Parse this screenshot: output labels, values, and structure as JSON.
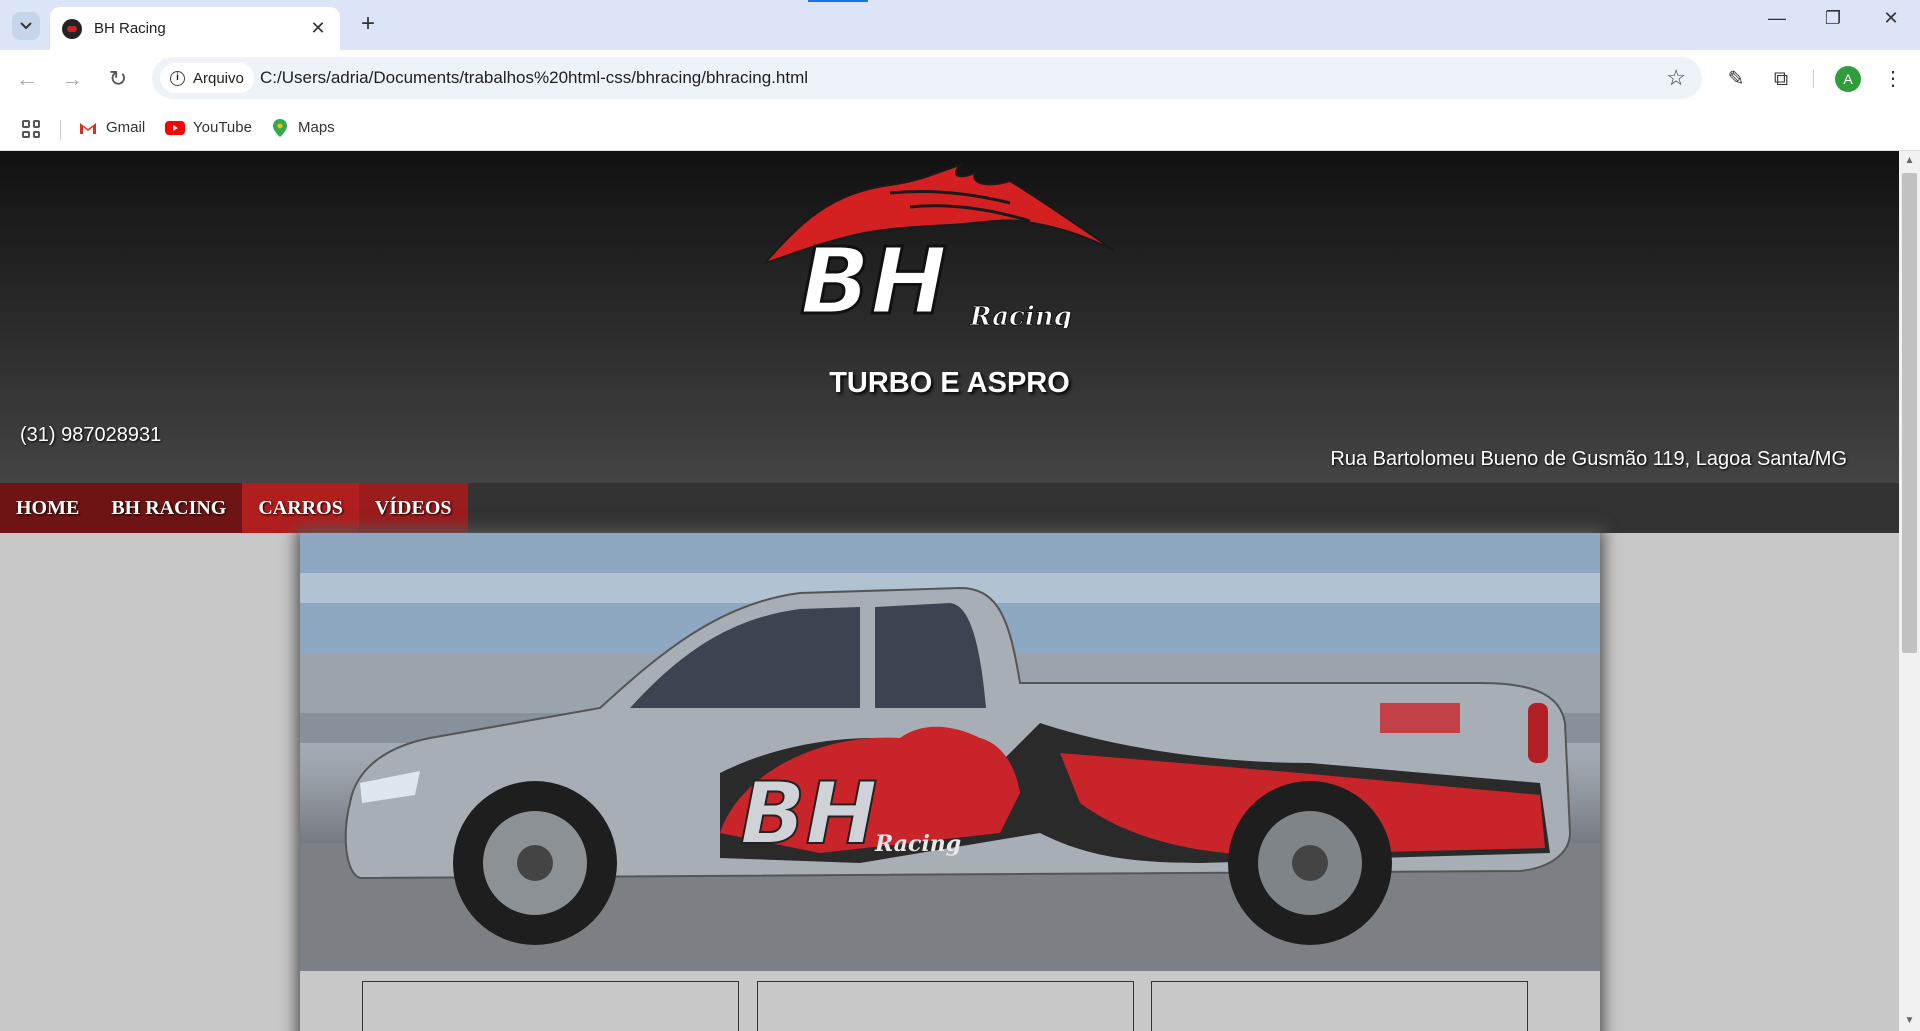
{
  "browser": {
    "tab_title": "BH Racing",
    "security_chip": "Arquivo",
    "url": "C:/Users/adria/Documents/trabalhos%20html-css/bhracing/bhracing.html",
    "profile_initial": "A",
    "bookmarks": [
      {
        "label": "Gmail",
        "icon": "gmail-icon"
      },
      {
        "label": "YouTube",
        "icon": "youtube-icon"
      },
      {
        "label": "Maps",
        "icon": "maps-icon"
      }
    ]
  },
  "site": {
    "logo_text": "BH",
    "logo_subtext": "Racing",
    "slogan": "TURBO E ASPRO",
    "phone": "(31) 987028931",
    "address": "Rua Bartolomeu Bueno de Gusmão 119, Lagoa Santa/MG",
    "menu": [
      {
        "label": "HOME"
      },
      {
        "label": "BH RACING"
      },
      {
        "label": "CARROS"
      },
      {
        "label": "VÍDEOS"
      }
    ],
    "hero_logo_text": "BH",
    "hero_logo_subtext": "Racing"
  },
  "colors": {
    "menu_bar": "#333333",
    "menu_red": "#9b1c1c",
    "logo_red": "#d42020",
    "page_bg": "#c8c8c8"
  }
}
